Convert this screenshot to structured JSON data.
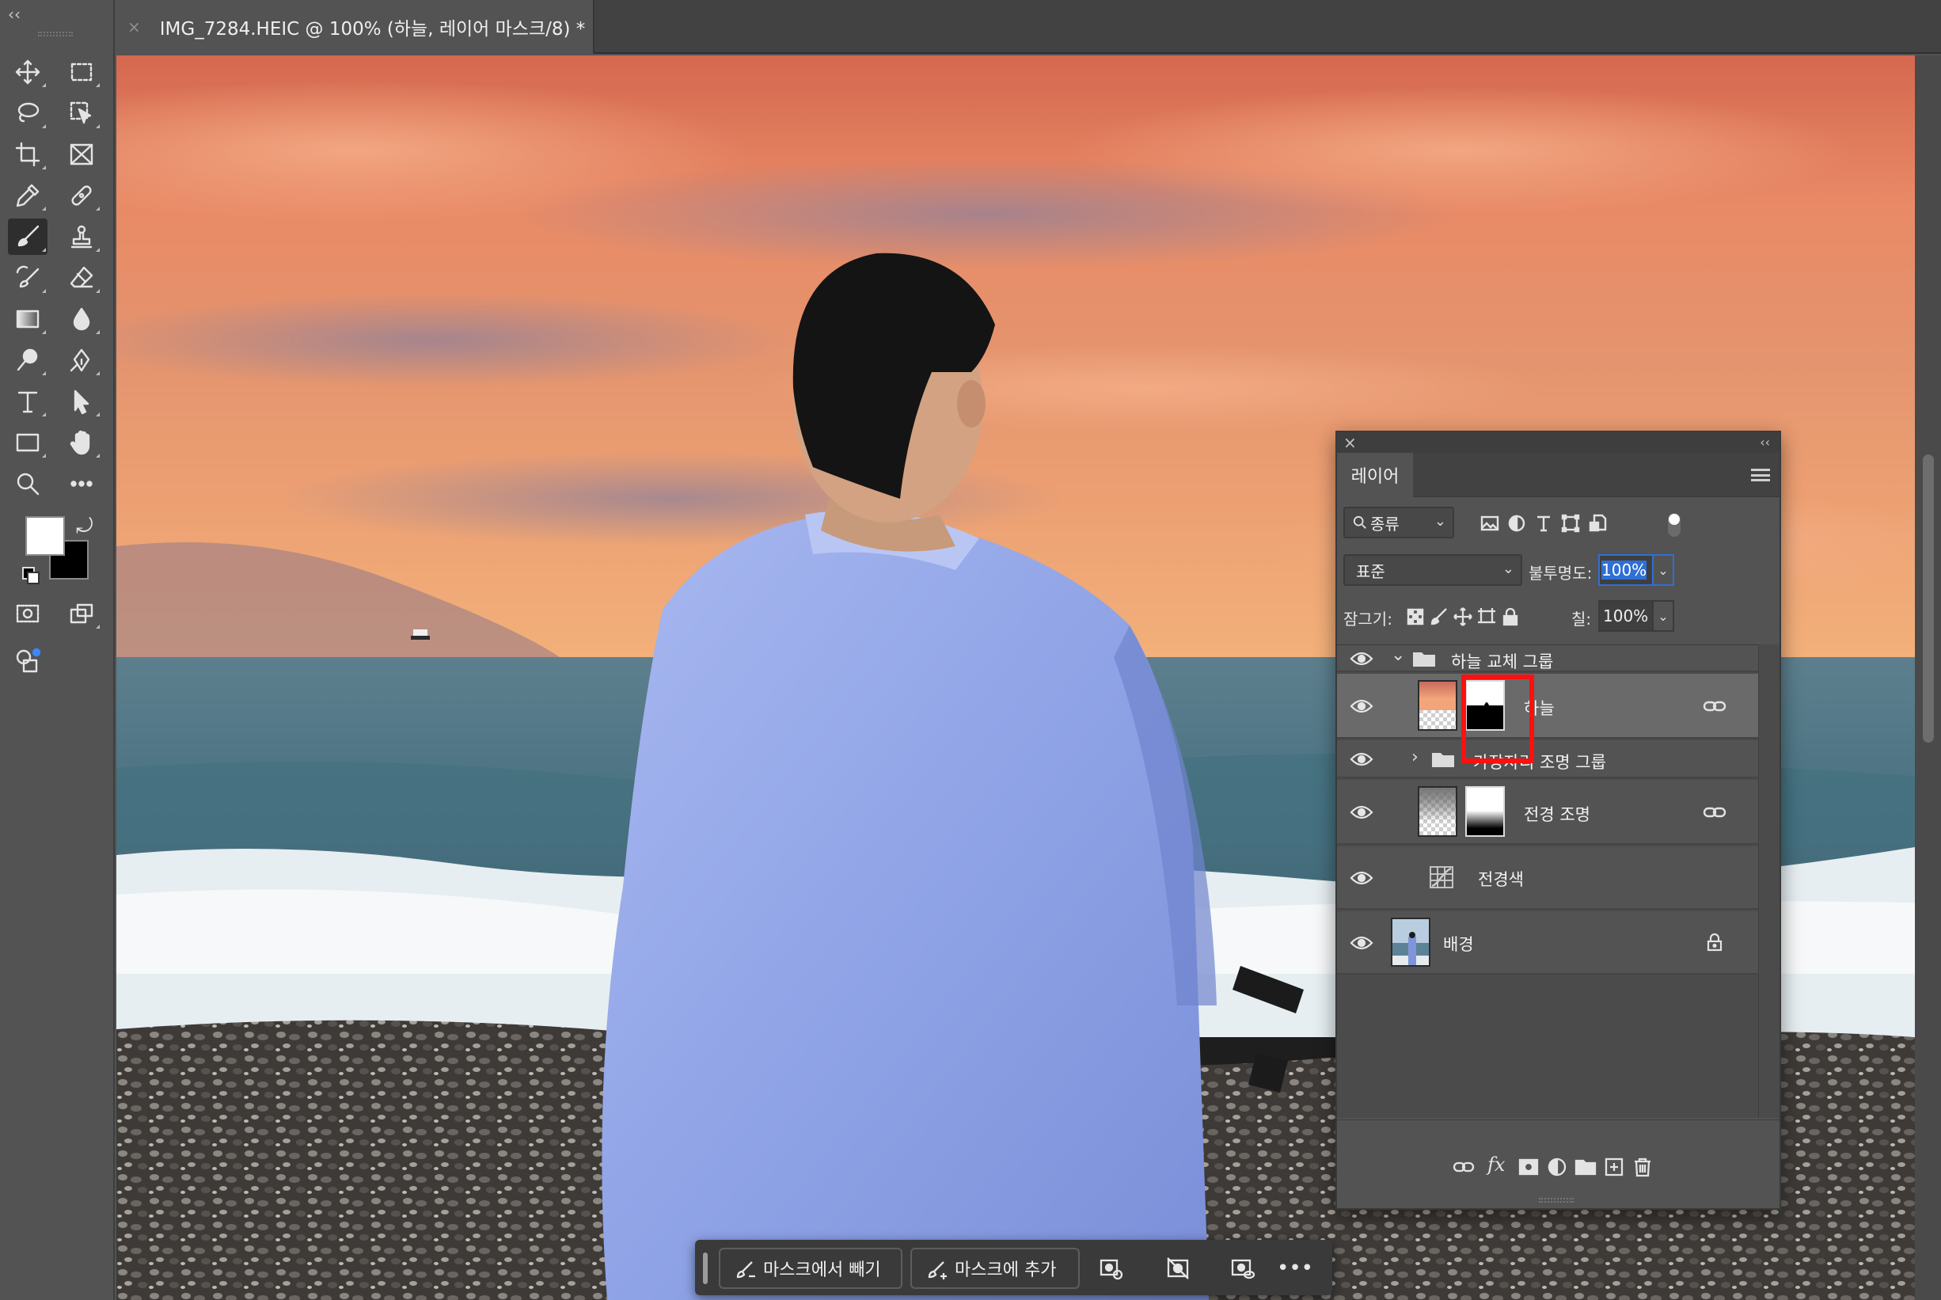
{
  "window": {
    "collapse_glyph": "‹‹"
  },
  "document_tab": {
    "close_glyph": "×",
    "title": "IMG_7284.HEIC @ 100% (하늘, 레이어 마스크/8) *"
  },
  "toolbar": {
    "tools": [
      {
        "name": "move-tool",
        "icon": "move-icon"
      },
      {
        "name": "marquee-tool",
        "icon": "rect-marquee-icon"
      },
      {
        "name": "lasso-tool",
        "icon": "lasso-icon"
      },
      {
        "name": "object-selection-tool",
        "icon": "object-select-icon"
      },
      {
        "name": "crop-tool",
        "icon": "crop-icon"
      },
      {
        "name": "frame-tool",
        "icon": "frame-icon"
      },
      {
        "name": "eyedropper-tool",
        "icon": "eyedropper-icon"
      },
      {
        "name": "healing-brush-tool",
        "icon": "bandage-icon"
      },
      {
        "name": "brush-tool",
        "icon": "brush-icon",
        "active": true
      },
      {
        "name": "clone-stamp-tool",
        "icon": "stamp-icon"
      },
      {
        "name": "history-brush-tool",
        "icon": "history-brush-icon"
      },
      {
        "name": "eraser-tool",
        "icon": "eraser-icon"
      },
      {
        "name": "gradient-tool",
        "icon": "gradient-icon"
      },
      {
        "name": "blur-tool",
        "icon": "drop-icon"
      },
      {
        "name": "dodge-tool",
        "icon": "dodge-icon"
      },
      {
        "name": "pen-tool",
        "icon": "pen-icon"
      },
      {
        "name": "type-tool",
        "icon": "type-icon"
      },
      {
        "name": "path-selection-tool",
        "icon": "arrow-icon"
      },
      {
        "name": "rectangle-tool",
        "icon": "rectangle-icon"
      },
      {
        "name": "hand-tool",
        "icon": "hand-icon"
      },
      {
        "name": "zoom-tool",
        "icon": "zoom-icon"
      },
      {
        "name": "more-tools",
        "icon": "ellipsis-icon"
      }
    ],
    "foreground_color": "#ffffff",
    "background_color": "#000000"
  },
  "layers_panel": {
    "close_glyph": "×",
    "collapse_glyph": "‹‹",
    "tab_label": "레이어",
    "filter": {
      "kind_label": "종류",
      "chevron": "⌄"
    },
    "blend_mode": "표준",
    "blend_chevron": "⌄",
    "opacity_label": "불투명도:",
    "opacity_value": "100%",
    "opacity_chevron": "⌄",
    "lock_label": "잠그기:",
    "fill_label": "칠:",
    "fill_value": "100%",
    "fill_chevron": "⌄",
    "layers": [
      {
        "name": "하늘 교체 그룹",
        "type": "group",
        "expanded": true,
        "visible": true
      },
      {
        "name": "하늘",
        "type": "layer-with-mask",
        "visible": true,
        "selected": true,
        "linked": true
      },
      {
        "name": "가장자리 조명 그룹",
        "type": "group",
        "expanded": false,
        "visible": true
      },
      {
        "name": "전경 조명",
        "type": "layer-with-mask",
        "visible": true,
        "linked": true
      },
      {
        "name": "전경색",
        "type": "adjustment",
        "visible": true
      },
      {
        "name": "배경",
        "type": "background",
        "visible": true,
        "locked": true
      }
    ],
    "twisty_open": "⌄",
    "twisty_closed": "›"
  },
  "context_bar": {
    "subtract_label": "마스크에서 빼기",
    "add_label": "마스크에 추가",
    "more_glyph": "•••"
  },
  "colors": {
    "ui_bg": "#535353",
    "selection_highlight": "#ff1010",
    "focus_blue": "#2f6fd6"
  }
}
